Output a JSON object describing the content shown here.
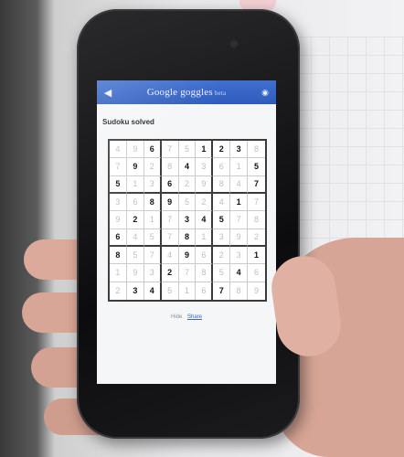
{
  "app_bar": {
    "back_icon": "back-arrow-icon",
    "title": "Google goggles",
    "subtitle": "beta",
    "settings_icon": "camera-icon"
  },
  "result": {
    "label": "",
    "title": "Sudoku solved"
  },
  "sudoku": {
    "rows": [
      [
        "4",
        "9",
        "6",
        "7",
        "5",
        "1",
        "2",
        "3",
        "8"
      ],
      [
        "7",
        "9",
        "2",
        "8",
        "4",
        "3",
        "6",
        "1",
        "5"
      ],
      [
        "5",
        "1",
        "3",
        "6",
        "2",
        "9",
        "8",
        "4",
        "7"
      ],
      [
        "3",
        "6",
        "8",
        "9",
        "5",
        "2",
        "4",
        "1",
        "7"
      ],
      [
        "9",
        "2",
        "1",
        "7",
        "3",
        "4",
        "5",
        "7",
        "8"
      ],
      [
        "6",
        "4",
        "5",
        "7",
        "8",
        "1",
        "3",
        "9",
        "2"
      ],
      [
        "8",
        "5",
        "7",
        "4",
        "9",
        "6",
        "2",
        "3",
        "1"
      ],
      [
        "1",
        "9",
        "3",
        "2",
        "7",
        "8",
        "5",
        "4",
        "6"
      ],
      [
        "2",
        "3",
        "4",
        "5",
        "1",
        "6",
        "7",
        "8",
        "9"
      ]
    ],
    "given": [
      [
        0,
        0,
        1,
        0,
        0,
        1,
        1,
        1,
        0
      ],
      [
        0,
        1,
        0,
        0,
        1,
        0,
        0,
        0,
        1
      ],
      [
        1,
        0,
        0,
        1,
        0,
        0,
        0,
        0,
        1
      ],
      [
        0,
        0,
        1,
        1,
        0,
        0,
        0,
        1,
        0
      ],
      [
        0,
        1,
        0,
        0,
        1,
        1,
        1,
        0,
        0
      ],
      [
        1,
        0,
        0,
        0,
        1,
        0,
        0,
        0,
        0
      ],
      [
        1,
        0,
        0,
        0,
        1,
        0,
        0,
        0,
        1
      ],
      [
        0,
        0,
        0,
        1,
        0,
        0,
        0,
        1,
        0
      ],
      [
        0,
        1,
        1,
        0,
        0,
        0,
        1,
        0,
        0
      ]
    ]
  },
  "footer": {
    "label": "Hide",
    "link": "Share"
  },
  "colors": {
    "app_bar": "#2f5cbd",
    "given_digit": "#111111",
    "solved_digit": "#b9bec6"
  }
}
